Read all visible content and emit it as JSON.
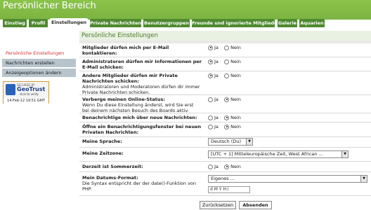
{
  "header": {
    "title": "Persönlicher Bereich"
  },
  "tabs": [
    {
      "label": "Einstieg"
    },
    {
      "label": "Profil"
    },
    {
      "label": "Einstellungen"
    },
    {
      "label": "Private Nachrichten"
    },
    {
      "label": "Benutzergruppen"
    },
    {
      "label": "Freunde und ignorierte Mitglieder"
    },
    {
      "label": "Galerie"
    },
    {
      "label": "Aquarien"
    }
  ],
  "sidebar": {
    "items": [
      {
        "label": "Persönliche Einstellungen"
      },
      {
        "label": "Nachrichten erstellen"
      },
      {
        "label": "Anzeigeoptionen ändern"
      }
    ],
    "badge": {
      "secured": "SECURED BY",
      "brand": "GeoTrust",
      "click": "click to verify",
      "date": "14-Feb-12 19:51 GMT"
    }
  },
  "panel": {
    "title": "Persönliche Einstellungen",
    "yes": "Ja",
    "no": "Nein",
    "rows": [
      {
        "label": "Mitglieder dürfen mich per E-Mail kontaktieren:"
      },
      {
        "label": "Administratoren dürfen mir Informationen per E-Mail schicken:"
      },
      {
        "label": "Andere Mitglieder dürfen mir Private Nachrichten schicken:",
        "desc": "Administratoren und Moderatoren dürfen dir immer Private Nachrichten schicken."
      },
      {
        "label": "Verberge meinen Online-Status:",
        "desc": "Wenn Du diese Einstellung änderst, wird Sie erst bei deinem nächsten Besuch des Boards aktiv."
      },
      {
        "label": "Benachrichtige mich über neue Nachrichten:"
      },
      {
        "label": "Öffne ein Benachrichtigungsfenster bei neuen Privaten Nachrichten:"
      },
      {
        "label": "Meine Sprache:",
        "value": "Deutsch (Du)"
      },
      {
        "label": "Meine Zeitzone:",
        "value": "[UTC + 1] Mitteleuropäische Zeit, West African ..."
      },
      {
        "label": "Derzeit ist Sommerzeit:"
      },
      {
        "label": "Mein Datums-Format:",
        "desc": "Die Syntax entspricht der der date()-Funktion von PHP.",
        "value": "Eigenes ...",
        "input": "d M Y H:i"
      }
    ]
  },
  "buttons": {
    "reset": "Zurücksetzen",
    "submit": "Absenden"
  }
}
